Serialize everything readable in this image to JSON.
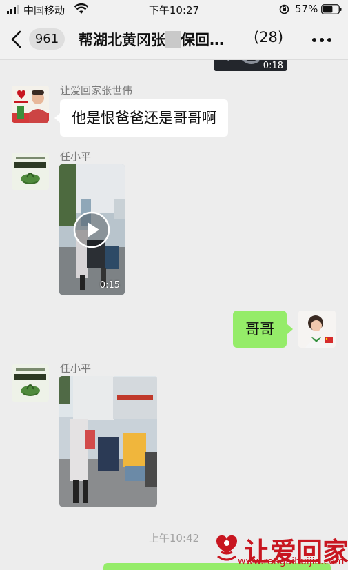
{
  "status_bar": {
    "carrier": "中国移动",
    "time": "下午10:27",
    "battery": "57%"
  },
  "nav": {
    "unread_count": "961",
    "title": "帮湖北黄冈张",
    "title_suffix": "保回…",
    "member_count": "(28)"
  },
  "messages": [
    {
      "type": "video",
      "direction": "out",
      "duration": "0:18"
    },
    {
      "type": "text",
      "direction": "in",
      "sender": "让爱回家张世伟",
      "text": "他是恨爸爸还是哥哥啊"
    },
    {
      "type": "video",
      "direction": "in",
      "sender": "任小平",
      "duration": "0:15"
    },
    {
      "type": "text",
      "direction": "out",
      "text": "哥哥"
    },
    {
      "type": "image",
      "direction": "in",
      "sender": "任小平"
    }
  ],
  "timestamp": "上午10:42",
  "watermark": {
    "text": "让爱回家",
    "url": "www.rangaihuijia.com",
    "color": "#c81620"
  },
  "colors": {
    "chat_bg": "#ededed",
    "outgoing_bubble": "#95ec69",
    "incoming_bubble": "#ffffff"
  }
}
